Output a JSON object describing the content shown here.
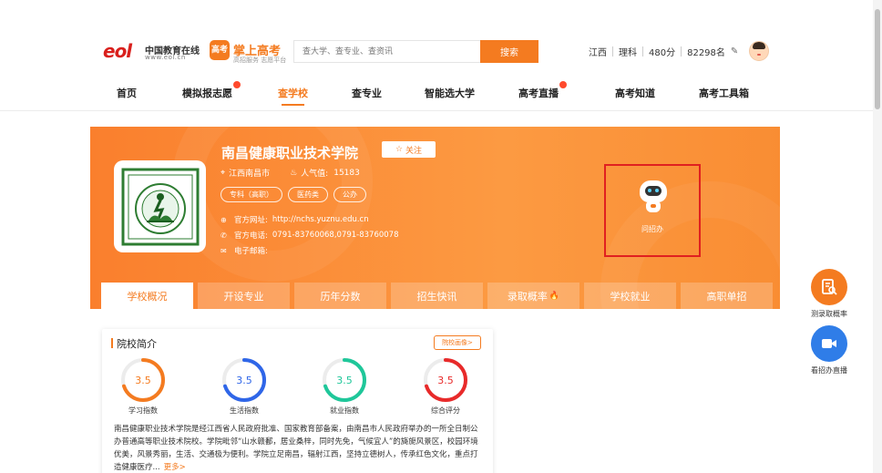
{
  "header": {
    "eol_logo_mark": "eol",
    "eol_logo_cn": "中国教育在线",
    "eol_logo_en": "www.eol.cn",
    "gaokao_badge": "高考",
    "gaokao_name": "掌上高考",
    "gaokao_sub": "高招服务 志愿平台",
    "search_placeholder": "查大学、查专业、查资讯",
    "search_button": "搜索",
    "province": "江西",
    "subject": "理科",
    "score": "480分",
    "rank": "82298名"
  },
  "nav": {
    "items": [
      {
        "label": "首页"
      },
      {
        "label": "模拟报志愿"
      },
      {
        "label": "查学校"
      },
      {
        "label": "查专业"
      },
      {
        "label": "智能选大学"
      },
      {
        "label": "高考直播"
      },
      {
        "label": "高考知道"
      },
      {
        "label": "高考工具箱"
      }
    ],
    "active": "查学校"
  },
  "school": {
    "name": "南昌健康职业技术学院",
    "follow": "关注",
    "location": "江西南昌市",
    "popularity_label": "人气值:",
    "popularity_value": "15183",
    "tags": [
      "专科（高职）",
      "医药类",
      "公办"
    ],
    "website_label": "官方网址:",
    "website": "http://nchs.yuznu.edu.cn",
    "phone_label": "官方电话:",
    "phone": "0791-83760068,0791-83760078",
    "email_label": "电子邮箱:",
    "email": "",
    "qa_label": "问招办"
  },
  "tabs": [
    "学校概况",
    "开设专业",
    "历年分数",
    "招生快讯",
    "录取概率",
    "学校就业",
    "高职单招"
  ],
  "intro_card": {
    "title": "院校简介",
    "link": "院校画像>",
    "gauges": [
      {
        "label": "学习指数",
        "value": "3.5",
        "color": "#f47b20"
      },
      {
        "label": "生活指数",
        "value": "3.5",
        "color": "#2f66e8"
      },
      {
        "label": "就业指数",
        "value": "3.5",
        "color": "#1fc79a"
      },
      {
        "label": "综合评分",
        "value": "3.5",
        "color": "#e82a2a"
      }
    ],
    "gauge_fraction": 0.7,
    "text": "南昌健康职业技术学院是经江西省人民政府批准、国家教育部备案，由南昌市人民政府举办的一所全日制公办普通高等职业技术院校。学院毗邻“山水赣鄱，居业桑梓，同时先免，气候宜人”的旖旎风景区，校园环境优美，风景秀丽，生活、交通极为便利。学院立足南昌，辐射江西，坚持立德树人，传承红色文化，重点打造健康医疗...",
    "more": "更多>"
  },
  "floats": [
    {
      "label": "测录取概率",
      "color": "#f47b20",
      "icon": "document-search-icon"
    },
    {
      "label": "看招办直播",
      "color": "#2f7de8",
      "icon": "live-video-icon"
    }
  ]
}
